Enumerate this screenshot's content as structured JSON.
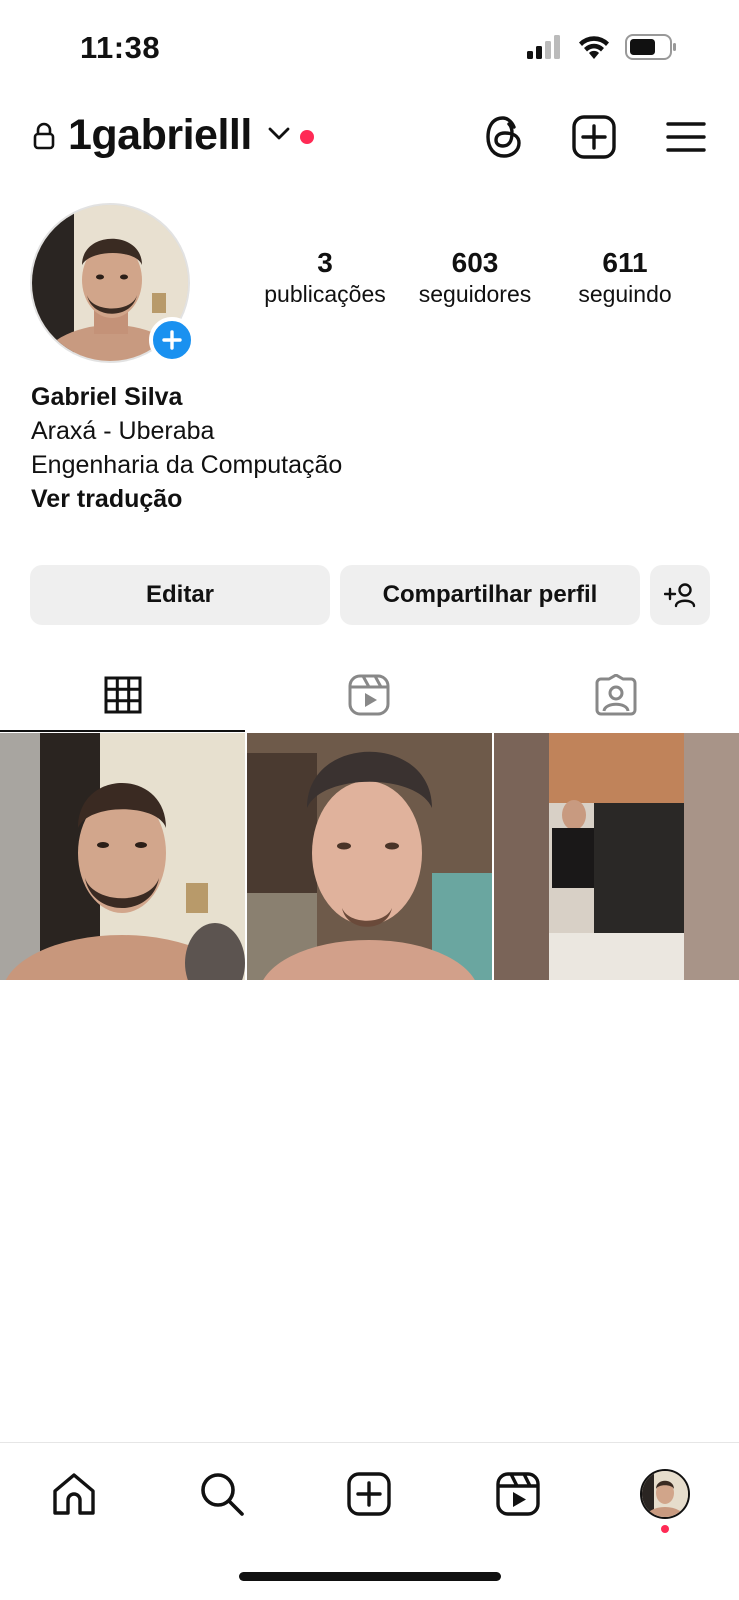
{
  "status_bar": {
    "time": "11:38",
    "battery_level": 0.6
  },
  "header": {
    "username": "1gabrielll",
    "icons": [
      "lock-icon",
      "chevron-down-icon",
      "threads-icon",
      "create-post-icon",
      "menu-icon"
    ]
  },
  "profile": {
    "stats": [
      {
        "value": "3",
        "label": "publicações"
      },
      {
        "value": "603",
        "label": "seguidores"
      },
      {
        "value": "611",
        "label": "seguindo"
      }
    ],
    "name": "Gabriel Silva",
    "bio_lines": [
      "Araxá - Uberaba",
      "Engenharia da Computação"
    ],
    "translate_label": "Ver tradução"
  },
  "actions": {
    "edit_label": "Editar",
    "share_label": "Compartilhar perfil"
  },
  "tabs": [
    {
      "name": "grid",
      "active": true
    },
    {
      "name": "reels",
      "active": false
    },
    {
      "name": "tagged",
      "active": false
    }
  ],
  "colors": {
    "accent_blue": "#1a91f0",
    "notification_red": "#ff2a55",
    "button_bg": "#efefef"
  }
}
